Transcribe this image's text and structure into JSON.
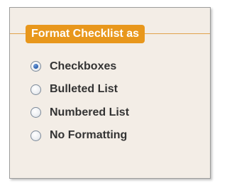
{
  "fieldset": {
    "legend": "Format Checklist as"
  },
  "options": [
    {
      "label": "Checkboxes",
      "checked": true
    },
    {
      "label": "Bulleted List",
      "checked": false
    },
    {
      "label": "Numbered List",
      "checked": false
    },
    {
      "label": "No Formatting",
      "checked": false
    }
  ],
  "colors": {
    "legend_bg": "#e8971c",
    "panel_bg": "#f3ede6",
    "radio_selected": "#2a5fad"
  }
}
